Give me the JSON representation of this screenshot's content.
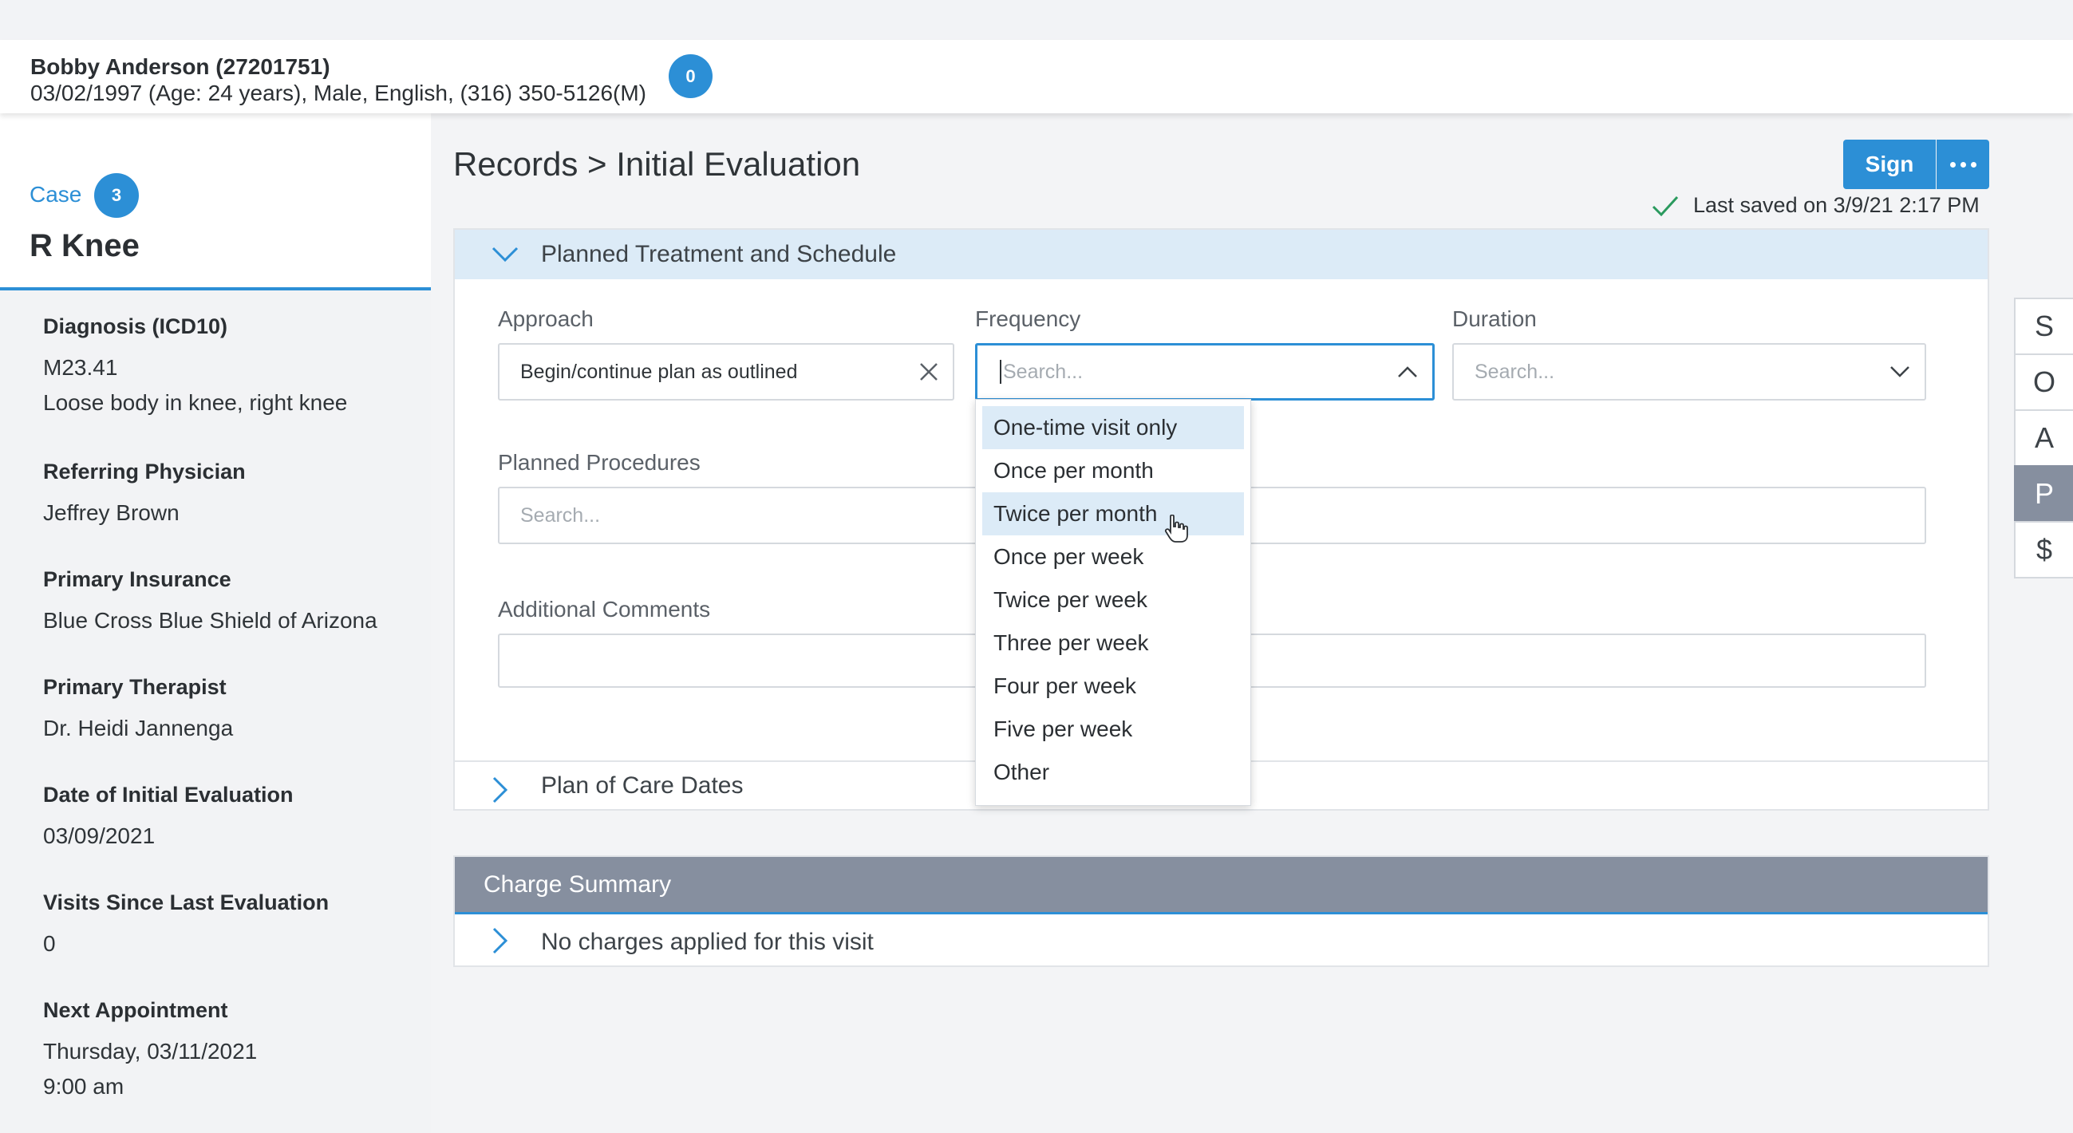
{
  "patient": {
    "name": "Bobby Anderson (27201751)",
    "details": "03/02/1997 (Age: 24 years), Male, English, (316) 350-5126(M)",
    "notification_count": "0"
  },
  "case": {
    "label": "Case",
    "count": "3",
    "title": "R Knee"
  },
  "sidebar": {
    "sections": [
      {
        "heading": "Diagnosis (ICD10)",
        "lines": [
          "M23.41",
          "Loose body in knee, right knee"
        ]
      },
      {
        "heading": "Referring Physician",
        "lines": [
          "Jeffrey Brown"
        ]
      },
      {
        "heading": "Primary Insurance",
        "lines": [
          "Blue Cross Blue Shield of Arizona"
        ]
      },
      {
        "heading": "Primary Therapist",
        "lines": [
          "Dr. Heidi Jannenga"
        ]
      },
      {
        "heading": "Date of Initial Evaluation",
        "lines": [
          "03/09/2021"
        ]
      },
      {
        "heading": "Visits Since Last Evaluation",
        "lines": [
          "0"
        ]
      },
      {
        "heading": "Next Appointment",
        "lines": [
          "Thursday, 03/11/2021",
          "9:00 am"
        ]
      }
    ]
  },
  "header": {
    "breadcrumb": "Records > Initial Evaluation",
    "sign_label": "Sign",
    "last_saved": "Last saved on 3/9/21 2:17 PM"
  },
  "planned_section": {
    "title": "Planned Treatment and Schedule",
    "approach_label": "Approach",
    "approach_value": "Begin/continue plan as outlined",
    "frequency_label": "Frequency",
    "frequency_placeholder": "Search...",
    "duration_label": "Duration",
    "duration_placeholder": "Search...",
    "procedures_label": "Planned Procedures",
    "procedures_placeholder": "Search...",
    "comments_label": "Additional Comments"
  },
  "plan_of_care": {
    "title": "Plan of Care Dates"
  },
  "frequency_options": [
    "One-time visit only",
    "Once per month",
    "Twice per month",
    "Once per week",
    "Twice per week",
    "Three per week",
    "Four per week",
    "Five per week",
    "Other"
  ],
  "charge_summary": {
    "title": "Charge Summary",
    "row": "No charges applied for this visit"
  },
  "soap_tabs": [
    "S",
    "O",
    "A",
    "P",
    "$"
  ],
  "colors": {
    "accent": "#2c8fd6",
    "section_header_bg": "#dcebf7",
    "charge_header_bg": "#868f9f"
  }
}
